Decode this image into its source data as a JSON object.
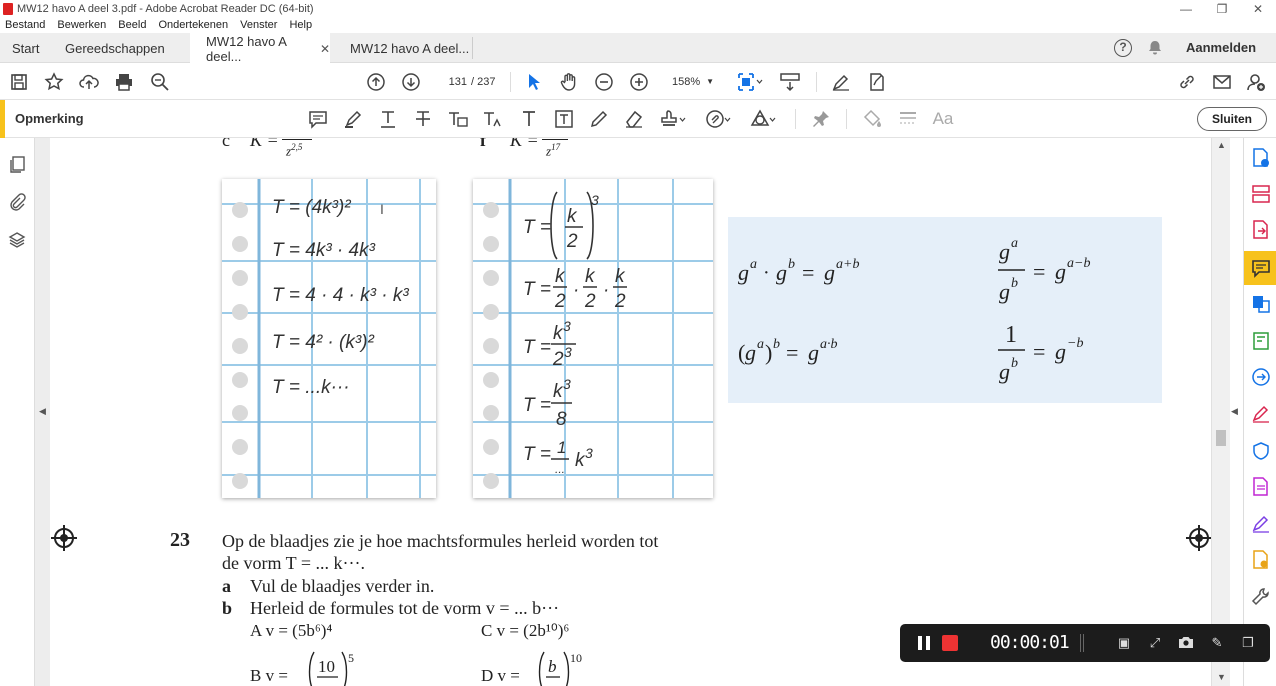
{
  "window": {
    "title": "MW12 havo A deel 3.pdf - Adobe Acrobat Reader DC (64-bit)"
  },
  "menu": [
    "Bestand",
    "Bewerken",
    "Beeld",
    "Ondertekenen",
    "Venster",
    "Help"
  ],
  "tabs": {
    "start": "Start",
    "tools": "Gereedschappen",
    "doc1": "MW12 havo A deel...",
    "doc2": "MW12 havo A deel..."
  },
  "header": {
    "signin": "Aanmelden"
  },
  "toolbar": {
    "page_current": "131",
    "page_total": "/ 237",
    "zoom": "158%"
  },
  "comment_toolbar": {
    "label": "Opmerking",
    "close_label": "Sluiten"
  },
  "page": {
    "top_left_formula": "K =",
    "top_left_den": "z",
    "top_left_exp": "2,5",
    "top_left_letter": "c",
    "top_right_letter": "f",
    "top_right_formula": "K =",
    "top_right_den": "z",
    "top_right_exp": "17",
    "sheet1": [
      "T = (4k³)²",
      "T = 4k³ · 4k³",
      "T = 4 · 4 · k³ · k³",
      "T = 4² · (k³)²",
      "T = ...k···"
    ],
    "sheet2_lines": [
      "T =",
      "T =",
      "T =",
      "T =",
      "T ="
    ],
    "rules": {
      "r1": "g",
      "r2": "(g",
      "r3": "g",
      "r4": "1"
    },
    "exercise": {
      "number": "23",
      "line1": "Op de blaadjes zie je hoe machtsformules herleid worden tot",
      "line2": "de vorm T = ... k···.",
      "a_letter": "a",
      "a_text": "Vul de blaadjes verder in.",
      "b_letter": "b",
      "b_text": "Herleid de formules tot de vorm v = ... b···",
      "A": "A   v = (5b⁶)⁴",
      "C": "C   v = (2b¹⁰)⁶",
      "B": "B   v =",
      "D": "D   v ="
    }
  },
  "recorder": {
    "time": "00:00:01"
  }
}
